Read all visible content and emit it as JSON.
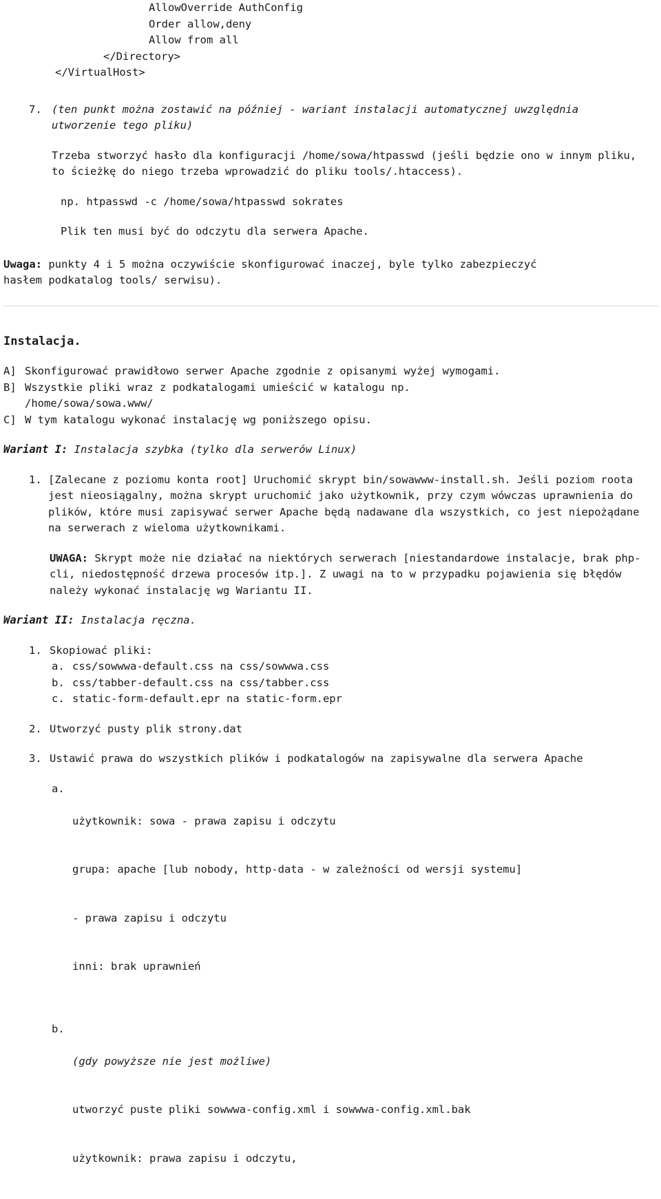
{
  "document": {
    "language": "pl",
    "code_block": {
      "lines": [
        "AllowOverride AuthConfig",
        "Order allow,deny",
        "Allow from all"
      ],
      "close_directory": "</Directory>",
      "close_virtualhost": "</VirtualHost>"
    },
    "item7": {
      "marker": "7.",
      "italic_note": "(ten punkt można zostawić na później - wariant instalacji automatycznej uwzględnia utworzenie tego pliku)",
      "paragraph": "Trzeba stworzyć hasło dla konfiguracji /home/sowa/htpasswd (jeśli będzie ono w innym pliku, to ścieżkę do niego trzeba wprowadzić do pliku tools/.htaccess).",
      "example_label": "np. htpasswd -c /home/sowa/htpasswd sokrates",
      "readable_note": "Plik ten musi być do odczytu dla serwera Apache."
    },
    "uwaga_block": {
      "label": "Uwaga:",
      "text": " punkty 4 i 5 można oczywiście skonfigurować inaczej, byle tylko zabezpieczyć hasłem podkatalog tools/ serwisu)."
    },
    "instalacja": {
      "heading": "Instalacja.",
      "steps": [
        {
          "marker": "A]",
          "text": "Skonfigurować prawidłowo serwer Apache zgodnie z opisanymi wyżej wymogami."
        },
        {
          "marker": "B]",
          "text": "Wszystkie pliki wraz z podkatalogami umieścić w katalogu np.\n/home/sowa/sowa.www/"
        },
        {
          "marker": "C]",
          "text": "W tym katalogu wykonać instalację wg poniższego opisu."
        }
      ]
    },
    "wariant1": {
      "label": "Wariant I:",
      "title": " Instalacja szybka (tylko dla serwerów Linux)",
      "step1": {
        "marker": "1.",
        "text": "[Zalecane z poziomu konta root] Uruchomić skrypt bin/sowawww-install.sh. Jeśli poziom roota jest nieosiągalny, można skrypt uruchomić jako użytkownik, przy czym wówczas uprawnienia do plików, które musi zapisywać serwer Apache będą nadawane dla wszystkich, co jest niepożądane na serwerach z wieloma użytkownikami."
      },
      "uwaga": {
        "label": "UWAGA:",
        "text": " Skrypt może nie działać na niektórych serwerach [niestandardowe instalacje, brak php-cli, niedostępność drzewa procesów itp.]. Z uwagi na to w przypadku pojawienia się błędów należy wykonać instalację wg Wariantu II."
      }
    },
    "wariant2": {
      "label": "Wariant II:",
      "title": " Instalacja ręczna.",
      "steps": [
        {
          "marker": "1.",
          "text": "Skopiować pliki:",
          "subitems": [
            {
              "marker": "a.",
              "text": "css/sowwwa-default.css na css/sowwwa.css"
            },
            {
              "marker": "b.",
              "text": "css/tabber-default.css na css/tabber.css"
            },
            {
              "marker": "c.",
              "text": "static-form-default.epr na static-form.epr"
            }
          ]
        },
        {
          "marker": "2.",
          "text": "Utworzyć pusty plik strony.dat",
          "subitems": []
        },
        {
          "marker": "3.",
          "text": "Ustawić prawa do wszystkich plików i podkatalogów na zapisywalne dla serwera Apache",
          "subitems": []
        }
      ],
      "permissions": {
        "a": {
          "marker": "a.",
          "lines": [
            "użytkownik: sowa - prawa zapisu i odczytu",
            "grupa: apache [lub nobody, http-data - w zależności od wersji systemu]",
            "- prawa zapisu i odczytu",
            "inni: brak uprawnień"
          ]
        },
        "b": {
          "marker": "b.",
          "italic_line": "(gdy powyższe nie jest możliwe)",
          "lines": [
            "utworzyć puste pliki sowwwa-config.xml i sowwwa-config.xml.bak",
            "użytkownik: prawa zapisu i odczytu,"
          ]
        }
      }
    }
  },
  "colors": {
    "text": "#1a1a1a",
    "rule": "#dcdcdc",
    "background": "#ffffff"
  }
}
